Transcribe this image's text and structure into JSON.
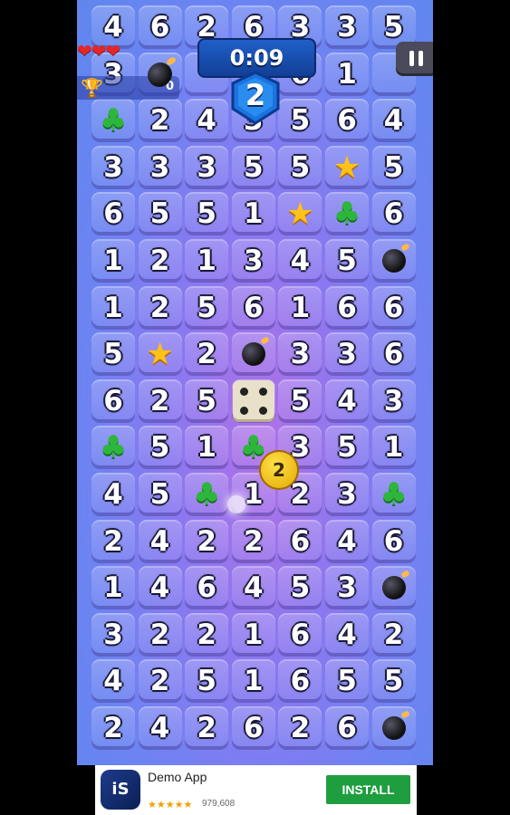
{
  "hud": {
    "timer": "0:09",
    "level": "2",
    "lives": 3,
    "score": "0",
    "pause_icon": "pause-icon"
  },
  "board": {
    "rows": [
      [
        "4",
        "6",
        "2",
        "6",
        "3",
        "3",
        "5"
      ],
      [
        "3",
        "bomb",
        "",
        "",
        "6",
        "1",
        ""
      ],
      [
        "clover",
        "2",
        "4",
        "3",
        "5",
        "6",
        "4"
      ],
      [
        "3",
        "3",
        "3",
        "5",
        "5",
        "star",
        "5"
      ],
      [
        "6",
        "5",
        "5",
        "1",
        "star",
        "clover",
        "6"
      ],
      [
        "1",
        "2",
        "1",
        "3",
        "4",
        "5",
        "bomb"
      ],
      [
        "1",
        "2",
        "5",
        "6",
        "1",
        "6",
        "6"
      ],
      [
        "5",
        "star",
        "2",
        "bomb",
        "3",
        "3",
        "6"
      ],
      [
        "6",
        "2",
        "5",
        "dice",
        "5",
        "4",
        "3"
      ],
      [
        "clover",
        "5",
        "1",
        "clover",
        "3",
        "5",
        "1"
      ],
      [
        "4",
        "5",
        "clover",
        "1",
        "2",
        "3",
        "clover"
      ],
      [
        "2",
        "4",
        "2",
        "2",
        "6",
        "4",
        "6"
      ],
      [
        "1",
        "4",
        "6",
        "4",
        "5",
        "3",
        "bomb"
      ],
      [
        "3",
        "2",
        "2",
        "1",
        "6",
        "4",
        "2"
      ],
      [
        "4",
        "2",
        "5",
        "1",
        "6",
        "5",
        "5"
      ],
      [
        "2",
        "4",
        "2",
        "6",
        "2",
        "6",
        "bomb"
      ]
    ],
    "coin_value": "2"
  },
  "ad": {
    "app_name": "Demo App",
    "icon_text": "iS",
    "rating_stars": "★★★★★",
    "rating_count": "979,608",
    "install_label": "INSTALL"
  }
}
